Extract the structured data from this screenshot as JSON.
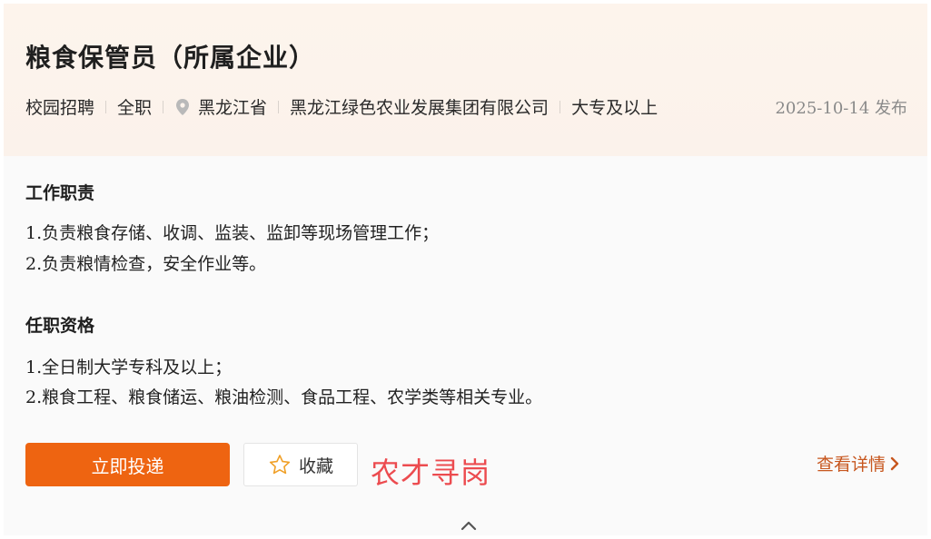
{
  "job": {
    "title": "粮食保管员（所属企业）",
    "recruit_type": "校园招聘",
    "work_type": "全职",
    "location": "黑龙江省",
    "company": "黑龙江绿色农业发展集团有限公司",
    "education": "大专及以上",
    "publish_date": "2025-10-14 发布"
  },
  "responsibilities": {
    "heading": "工作职责",
    "items": [
      "1.负责粮食存储、收调、监装、监卸等现场管理工作；",
      "2.负责粮情检查，安全作业等。"
    ]
  },
  "qualifications": {
    "heading": "任职资格",
    "items": [
      "1.全日制大学专科及以上；",
      "2.粮食工程、粮食储运、粮油检测、食品工程、农学类等相关专业。"
    ]
  },
  "actions": {
    "apply_label": "立即投递",
    "favorite_label": "收藏",
    "details_label": "查看详情"
  },
  "watermark_text": "农才寻岗",
  "icons": {
    "location": "location-pin-icon",
    "favorite": "star-outline-icon",
    "details": "chevron-right-icon",
    "collapse": "chevron-up-icon"
  },
  "colors": {
    "accent": "#ee6411",
    "link": "#c7561e",
    "watermark": "#ec4b4f",
    "header_bg": "#fdf4ec"
  }
}
